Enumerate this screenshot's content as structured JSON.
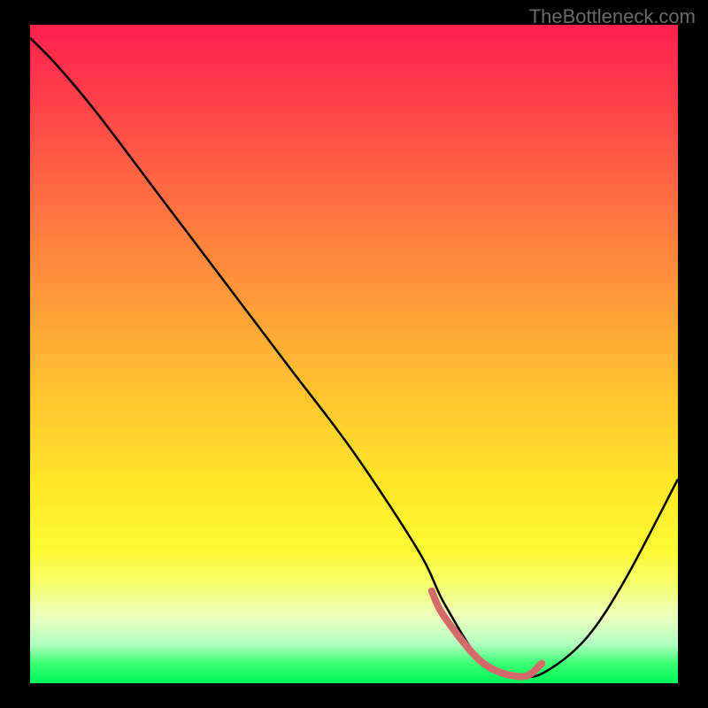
{
  "watermark": "TheBottleneck.com",
  "chart_data": {
    "type": "line",
    "title": "",
    "xlabel": "",
    "ylabel": "",
    "xlim": [
      0,
      100
    ],
    "ylim": [
      0,
      100
    ],
    "series": [
      {
        "name": "curve",
        "x": [
          0,
          4,
          10,
          20,
          30,
          40,
          50,
          60,
          64,
          70,
          76,
          80,
          86,
          92,
          100
        ],
        "y": [
          98,
          94,
          87,
          74,
          61,
          48,
          35,
          20,
          12,
          3,
          1,
          2,
          7,
          16,
          31
        ]
      }
    ],
    "highlight_segment": {
      "x": [
        62,
        64,
        70,
        76,
        79
      ],
      "y": [
        14,
        10,
        3,
        1,
        3
      ],
      "color": "#d46a6a",
      "stroke_width": 8
    },
    "gradient_stops": [
      {
        "pos": 0,
        "color": "#ff214e"
      },
      {
        "pos": 25,
        "color": "#ff6a43"
      },
      {
        "pos": 55,
        "color": "#ffc130"
      },
      {
        "pos": 80,
        "color": "#fdfa36"
      },
      {
        "pos": 94,
        "color": "#b3ffbf"
      },
      {
        "pos": 100,
        "color": "#00f558"
      }
    ]
  }
}
